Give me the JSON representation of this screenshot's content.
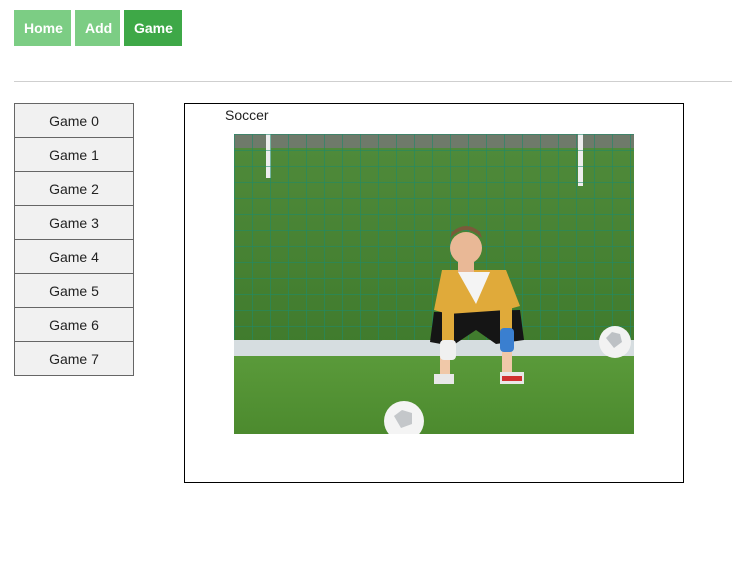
{
  "nav": {
    "home_label": "Home",
    "add_label": "Add",
    "game_label": "Game"
  },
  "sidebar": {
    "items": [
      {
        "label": "Game 0"
      },
      {
        "label": "Game 1"
      },
      {
        "label": "Game 2"
      },
      {
        "label": "Game 3"
      },
      {
        "label": "Game 4"
      },
      {
        "label": "Game 5"
      },
      {
        "label": "Game 6"
      },
      {
        "label": "Game 7"
      }
    ]
  },
  "content": {
    "title": "Soccer"
  },
  "colors": {
    "nav_light": "#7ccd84",
    "nav_active": "#3ea847"
  }
}
